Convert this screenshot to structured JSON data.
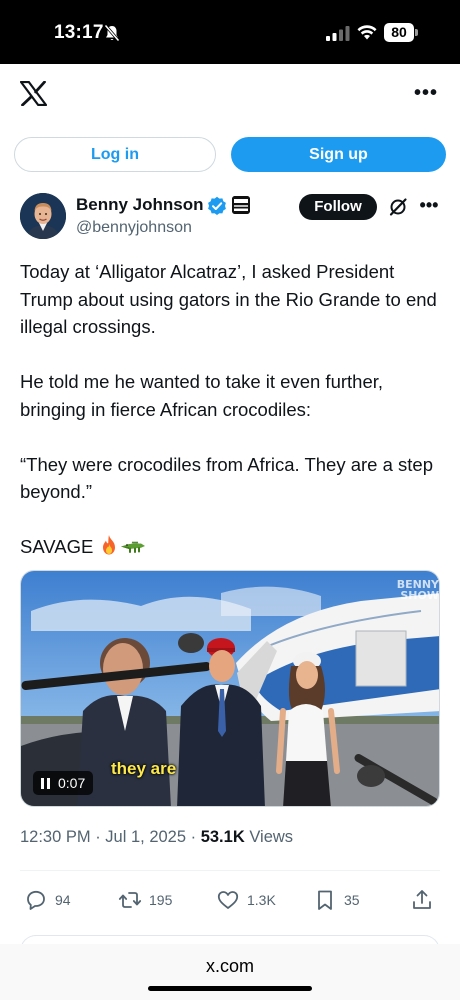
{
  "status_bar": {
    "time": "13:17",
    "battery": "80"
  },
  "header": {
    "logo": "x-logo",
    "more": "•••"
  },
  "auth": {
    "login_label": "Log in",
    "signup_label": "Sign up"
  },
  "author": {
    "name": "Benny Johnson",
    "handle": "@bennyjohnson",
    "verified": true,
    "follow_label": "Follow"
  },
  "tweet": {
    "paragraphs": [
      "Today at ‘Alligator Alcatraz’, I asked President Trump about using gators in the Rio Grande to end illegal crossings.",
      "He told me he wanted to take it even further, bringing in fierce African crocodiles:",
      "“They were crocodiles from Africa. They are a step beyond.”",
      "SAVAGE"
    ],
    "emojis": [
      "fire-emoji",
      "crocodile-emoji"
    ]
  },
  "media": {
    "caption": "they are",
    "watermark_line1": "BENNY",
    "watermark_line2": "SHOW",
    "duration": "0:07"
  },
  "meta": {
    "time": "12:30 PM",
    "date": "Jul 1, 2025",
    "views_count": "53.1K",
    "views_label": "Views"
  },
  "actions": {
    "replies": "94",
    "reposts": "195",
    "likes": "1.3K",
    "bookmarks": "35"
  },
  "browser": {
    "url": "x.com"
  },
  "colors": {
    "accent": "#1d9bf0",
    "text": "#0f1419",
    "secondary": "#536471"
  }
}
